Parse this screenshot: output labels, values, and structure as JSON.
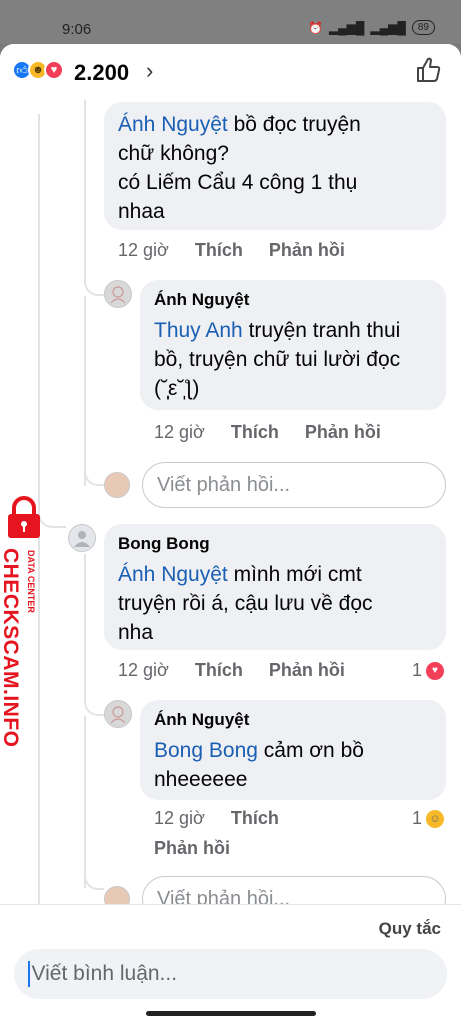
{
  "status_bar": {
    "time": "9:06",
    "battery": "89"
  },
  "header": {
    "reaction_count": "2.200",
    "chevron": "›"
  },
  "thread": {
    "c1": {
      "mention": "Ánh Nguyệt",
      "text_1": " bồ đọc truyện",
      "text_2": "chữ không?",
      "text_3": "có Liếm Cẩu 4 công 1 thụ",
      "text_4": "nhaa",
      "age": "12 giờ",
      "like": "Thích",
      "reply": "Phản hồi"
    },
    "r1": {
      "author": "Ánh Nguyệt",
      "mention": "Thuy Anh",
      "text_1": " truyện tranh thui",
      "text_2": "bồ, truyện chữ tui lười đọc",
      "text_3": "(˘̩̩̩ε˘̩ƪ)",
      "age": "12 giờ",
      "like": "Thích",
      "reply": "Phản hồi"
    },
    "reply_placeholder_1": "Viết phản hồi...",
    "c2": {
      "author": "Bong Bong",
      "mention": "Ánh Nguyệt",
      "text_1": " mình mới cmt",
      "text_2": "truyện rồi á, cậu lưu về đọc",
      "text_3": "nha",
      "age": "12 giờ",
      "like": "Thích",
      "reply": "Phản hồi",
      "reactions": "1"
    },
    "r2": {
      "author": "Ánh Nguyệt",
      "mention": "Bong Bong",
      "text_1": " cảm ơn bồ",
      "text_2": "nheeeeee",
      "age": "12 giờ",
      "like": "Thích",
      "reply": "Phản hồi",
      "reactions": "1"
    },
    "reply_placeholder_2": "Viết phản hồi..."
  },
  "watermark": {
    "main": "CHECKSCAM.INFO",
    "sub": "DATA CENTER"
  },
  "footer": {
    "rules": "Quy tắc",
    "placeholder": "Viết bình luận..."
  },
  "colors": {
    "mention": "#1a5fb4",
    "like_blue": "#1877f2",
    "love_red": "#f33e58",
    "watermark_red": "#e5141e"
  }
}
